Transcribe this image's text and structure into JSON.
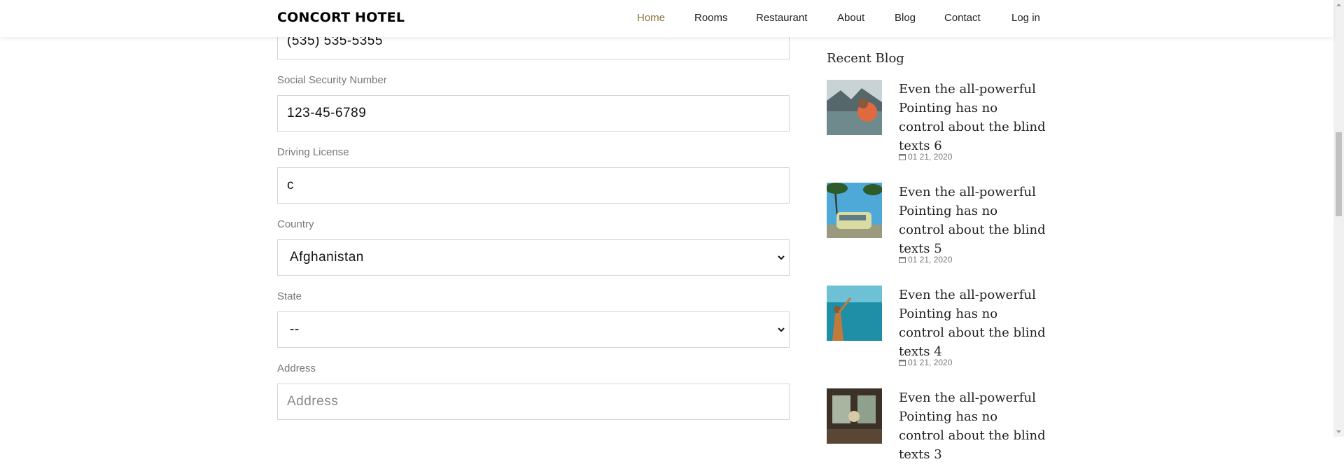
{
  "header": {
    "brand": "CONCORT HOTEL",
    "nav": [
      "Home",
      "Rooms",
      "Restaurant",
      "About",
      "Blog",
      "Contact",
      "Log in"
    ],
    "active": "Home"
  },
  "form": {
    "phone_value": "(535) 535-5355",
    "ssn_label": "Social Security Number",
    "ssn_value": "123-45-6789",
    "license_label": "Driving License",
    "license_value": "c",
    "country_label": "Country",
    "country_value": "Afghanistan",
    "state_label": "State",
    "state_value": "--",
    "address_label": "Address",
    "address_placeholder": "Address"
  },
  "sidebar": {
    "title": "Recent Blog",
    "posts": [
      {
        "title": "Even the all-powerful Pointing has no control about the blind texts 6",
        "date": "01 21, 2020",
        "thumb": "lake-hiker"
      },
      {
        "title": "Even the all-powerful Pointing has no control about the blind texts 5",
        "date": "01 21, 2020",
        "thumb": "van-palms"
      },
      {
        "title": "Even the all-powerful Pointing has no control about the blind texts 4",
        "date": "01 21, 2020",
        "thumb": "sea-woman"
      },
      {
        "title": "Even the all-powerful Pointing has no control about the blind texts 3",
        "date": "",
        "thumb": "room-interior"
      }
    ]
  },
  "colors": {
    "accent": "#8d703b",
    "border": "#d6d6d6",
    "label": "#777777"
  }
}
